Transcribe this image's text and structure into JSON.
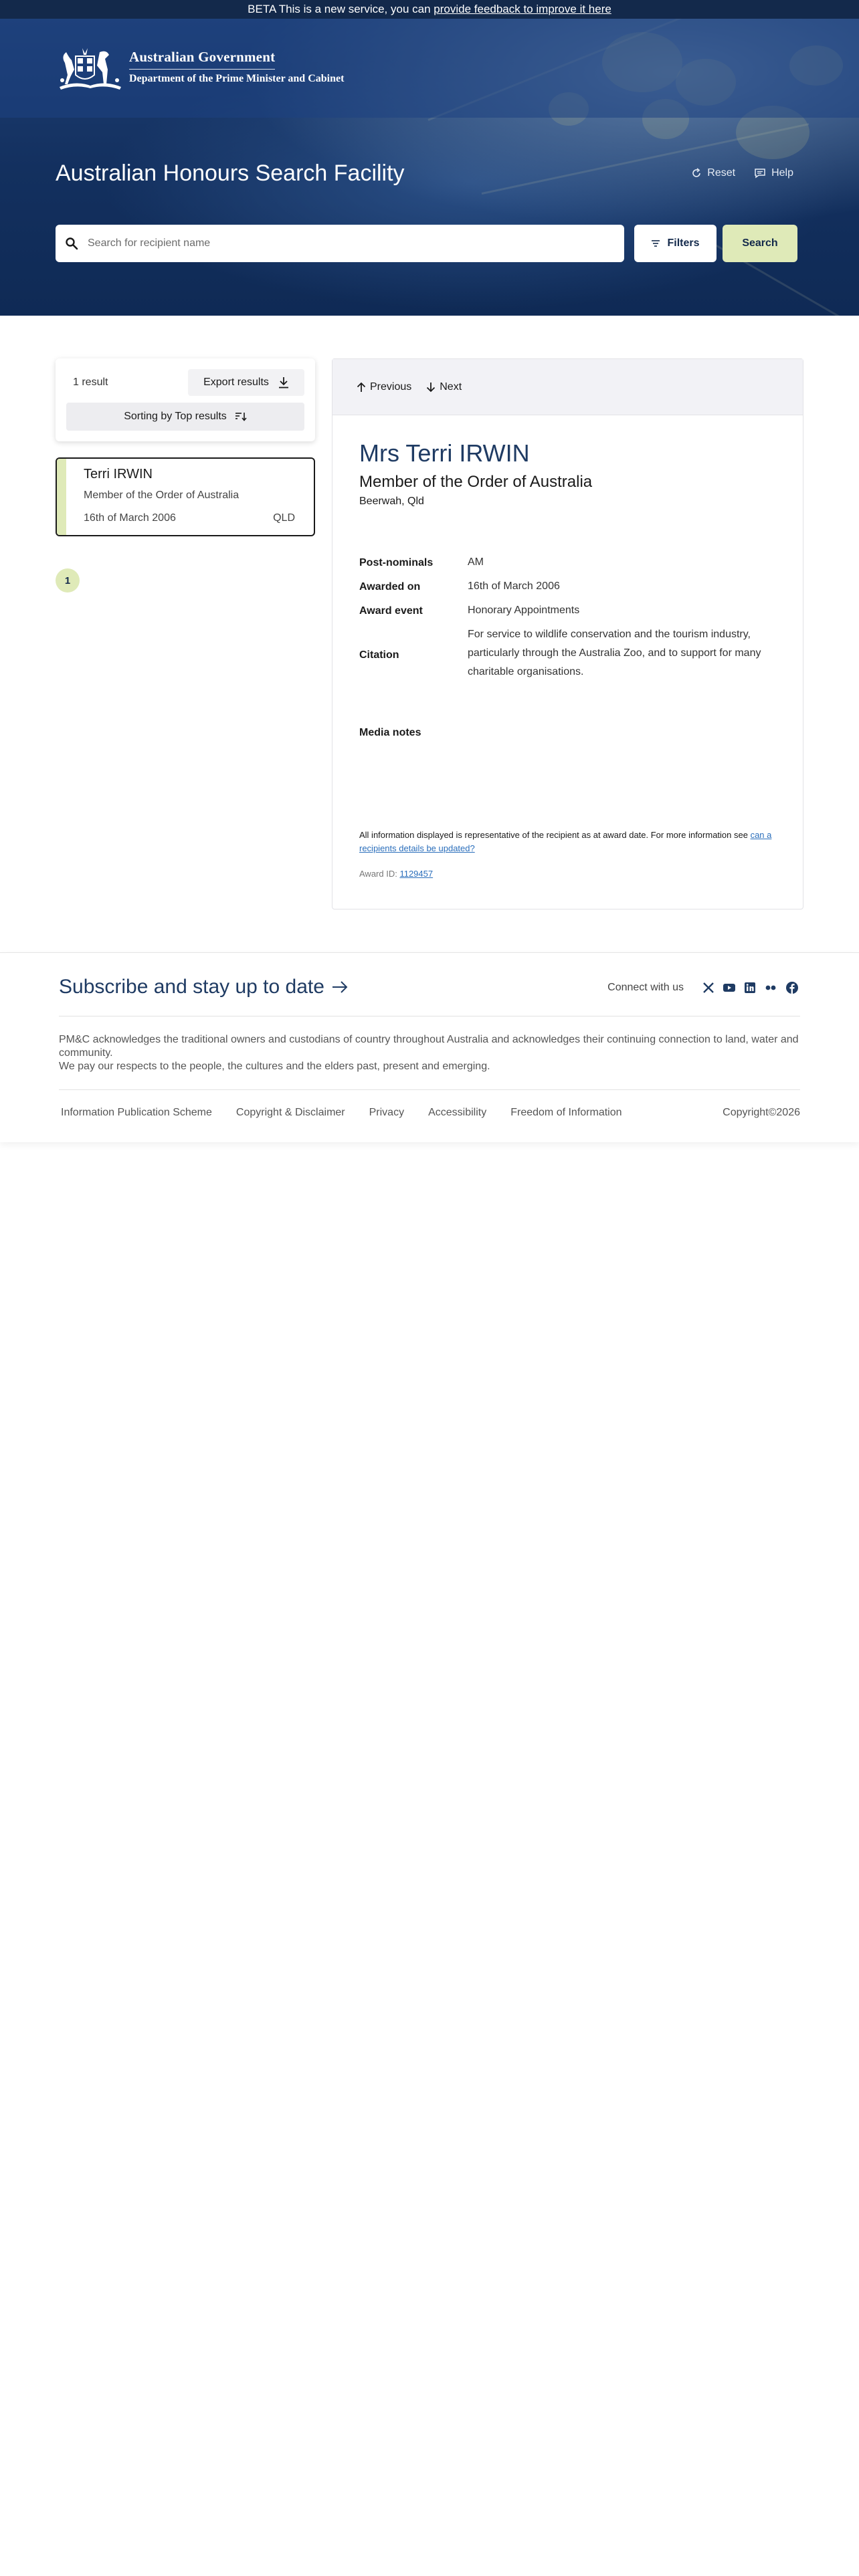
{
  "banner": {
    "prefix": "BETA This is a new service, you can ",
    "link": "provide feedback to improve it here"
  },
  "header": {
    "gov_name": "Australian Government",
    "dept_name": "Department of the Prime Minister and Cabinet"
  },
  "hero": {
    "title": "Australian Honours Search Facility",
    "reset_label": "Reset",
    "help_label": "Help",
    "search_placeholder": "Search for recipient name",
    "filters_label": "Filters",
    "search_label": "Search"
  },
  "results": {
    "count": "1 result",
    "export_label": "Export results",
    "sort_label": "Sorting by Top results",
    "items": [
      {
        "name": "Terri IRWIN",
        "award": "Member of the Order of Australia",
        "date": "16th of March 2006",
        "state": "QLD"
      }
    ],
    "page": "1"
  },
  "detail": {
    "prev_label": "Previous",
    "next_label": "Next",
    "title": "Mrs Terri IRWIN",
    "award": "Member of the Order of Australia",
    "place": "Beerwah, Qld",
    "fields": [
      {
        "label": "Post-nominals",
        "value": "AM"
      },
      {
        "label": "Awarded on",
        "value": "16th of March 2006"
      },
      {
        "label": "Award event",
        "value": "Honorary Appointments"
      },
      {
        "label": "Citation",
        "value": "For service to wildlife conservation and the tourism industry, particularly through the Australia Zoo, and to support for many charitable organisations."
      }
    ],
    "media_notes_label": "Media notes",
    "disclaimer_text": "All information displayed is representative of the recipient as at award date. For more information see ",
    "disclaimer_link": "can a recipients details be updated?",
    "award_id_label": "Award ID: ",
    "award_id": "1129457"
  },
  "footer": {
    "subscribe": "Subscribe and stay up to date",
    "connect": "Connect with us",
    "social_icons": [
      "x-icon",
      "youtube-icon",
      "linkedin-icon",
      "flickr-icon",
      "facebook-icon"
    ],
    "ack_line1": "PM&C acknowledges the traditional owners and custodians of country throughout Australia and acknowledges their continuing connection to land, water and community.",
    "ack_line2": "We pay our respects to the people, the cultures and the elders past, present and emerging.",
    "links": [
      "Information Publication Scheme",
      "Copyright & Disclaimer",
      "Privacy",
      "Accessibility",
      "Freedom of Information"
    ],
    "copyright": "Copyright©2026"
  },
  "colors": {
    "navy": "#13294b",
    "accent_green": "#dfeab8",
    "heading_blue": "#1f3b63",
    "link_blue": "#2a6ebb"
  }
}
